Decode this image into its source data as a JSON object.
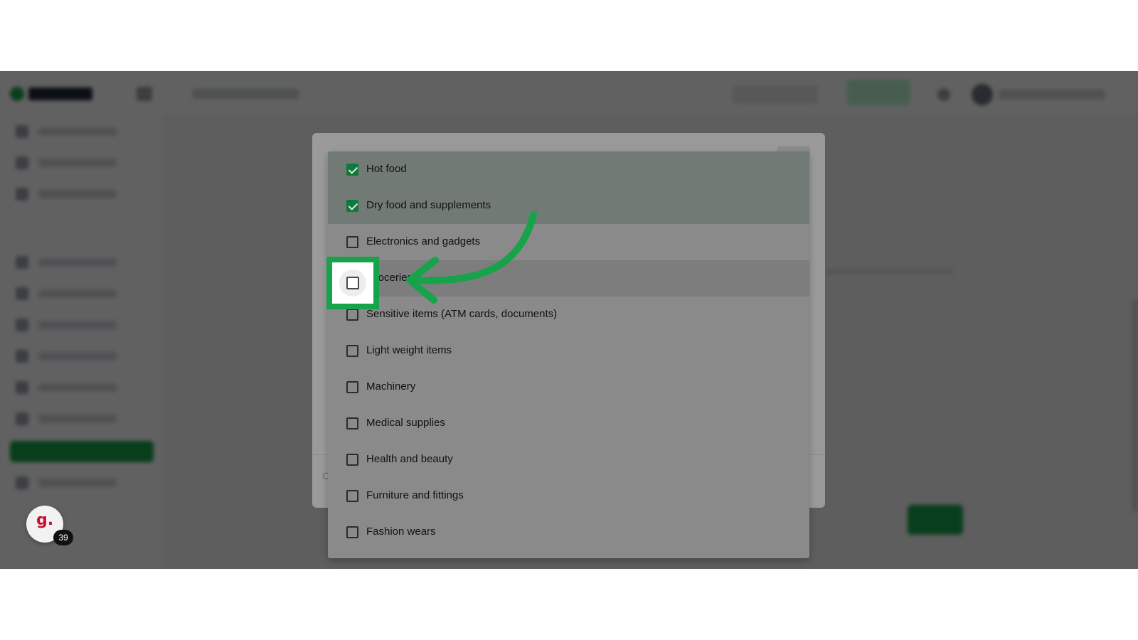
{
  "dropdown": {
    "options": [
      {
        "label": "Hot food",
        "checked": true
      },
      {
        "label": "Dry food and supplements",
        "checked": true
      },
      {
        "label": "Electronics and gadgets",
        "checked": false
      },
      {
        "label": "Groceries",
        "checked": false
      },
      {
        "label": "Sensitive items (ATM cards, documents)",
        "checked": false
      },
      {
        "label": "Light weight items",
        "checked": false
      },
      {
        "label": "Machinery",
        "checked": false
      },
      {
        "label": "Medical supplies",
        "checked": false
      },
      {
        "label": "Health and beauty",
        "checked": false
      },
      {
        "label": "Furniture and fittings",
        "checked": false
      },
      {
        "label": "Fashion wears",
        "checked": false
      }
    ]
  },
  "modal": {
    "cancel_label": "C"
  },
  "badge": {
    "letter": "g.",
    "count": "39"
  },
  "colors": {
    "accent": "#16a34a",
    "checked": "#0e7a3a",
    "badge_letter": "#c8102e"
  },
  "icons": {
    "arrow": "curved-arrow-icon",
    "check": "check-icon"
  }
}
